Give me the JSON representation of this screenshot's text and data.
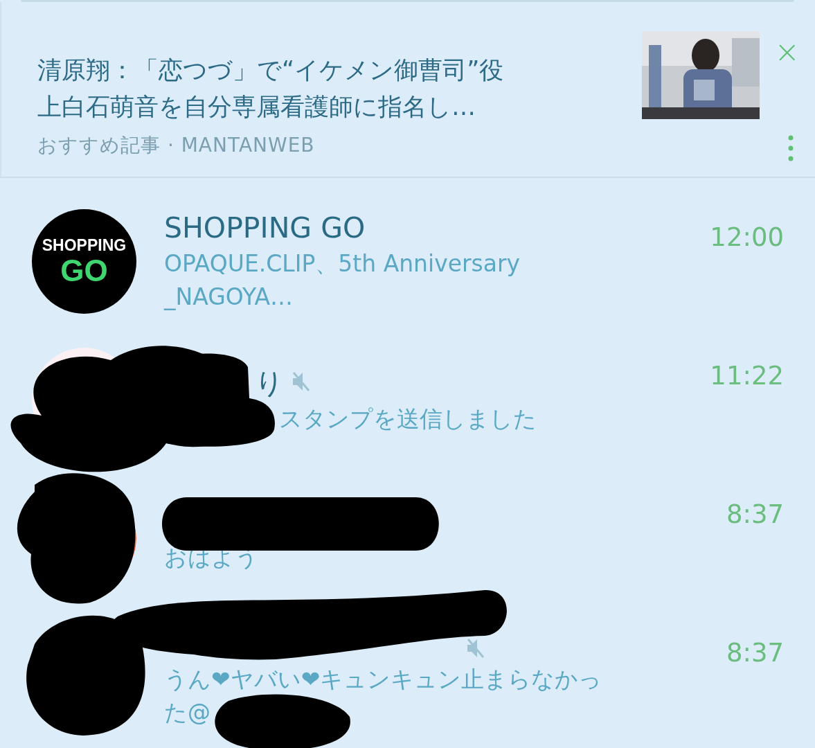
{
  "article": {
    "title_lines": [
      "清原翔：「恋つづ」で“イケメン御曹司”役",
      "上白石萌音を自分専属看護師に指名し…"
    ],
    "source": "おすすめ記事 · MANTANWEB",
    "thumbnail": {
      "kind": "picture"
    },
    "close": "×"
  },
  "chats": [
    {
      "avatar": {
        "kind": "logo",
        "line_1": "SHOPPING",
        "line_2": "GO"
      },
      "name": "SHOPPING GO",
      "muted": false,
      "preview_lines": [
        "OPAQUE.CLIP、5th Anniversary",
        "_NAGOYA…"
      ],
      "time": "12:00"
    },
    {
      "avatar": {
        "kind": "picture"
      },
      "name": "り",
      "muted": true,
      "preview_lines": [
        "スタンプを送信しました"
      ],
      "time": "11:22"
    },
    {
      "avatar": {
        "kind": "picture"
      },
      "muted": false,
      "preview_lines": [
        "おはよう"
      ],
      "time": "8:37"
    },
    {
      "muted": true,
      "preview_lines": [
        "うん❤ヤバい❤キュンキュン止まらなかっ",
        "た@"
      ],
      "time": "8:37"
    }
  ]
}
